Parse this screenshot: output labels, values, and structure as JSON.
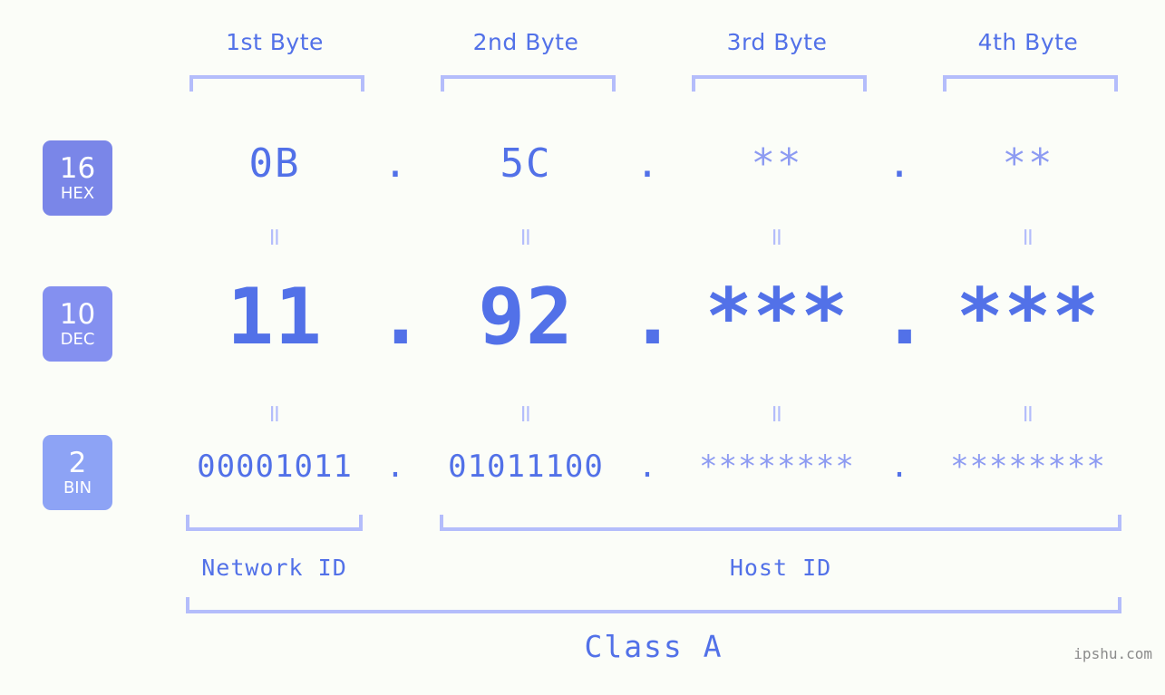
{
  "header": {
    "byte_labels": [
      "1st Byte",
      "2nd Byte",
      "3rd Byte",
      "4th Byte"
    ]
  },
  "radix_badges": [
    {
      "number": "16",
      "name": "HEX",
      "color": "#7a86e8"
    },
    {
      "number": "10",
      "name": "DEC",
      "color": "#8490f0"
    },
    {
      "number": "2",
      "name": "BIN",
      "color": "#8da3f5"
    }
  ],
  "rows": {
    "hex": {
      "radix": "16",
      "radix_name": "HEX",
      "bytes": [
        "0B",
        "5C",
        "**",
        "**"
      ],
      "masked": [
        false,
        false,
        true,
        true
      ],
      "separator": "."
    },
    "dec": {
      "radix": "10",
      "radix_name": "DEC",
      "bytes": [
        "11",
        "92",
        "***",
        "***"
      ],
      "masked": [
        false,
        false,
        false,
        false
      ],
      "separator": "."
    },
    "bin": {
      "radix": "2",
      "radix_name": "BIN",
      "bytes": [
        "00001011",
        "01011100",
        "********",
        "********"
      ],
      "masked": [
        false,
        false,
        true,
        true
      ],
      "separator": "."
    }
  },
  "connectors": {
    "glyph": "="
  },
  "sections": {
    "network_id": "Network ID",
    "host_id": "Host ID",
    "class": "Class A"
  },
  "watermark": "ipshu.com",
  "colors": {
    "background": "#fbfdf8",
    "primary_text": "#5271e8",
    "masked_text": "#8d9bf2",
    "bracket": "#b4bdfb"
  }
}
